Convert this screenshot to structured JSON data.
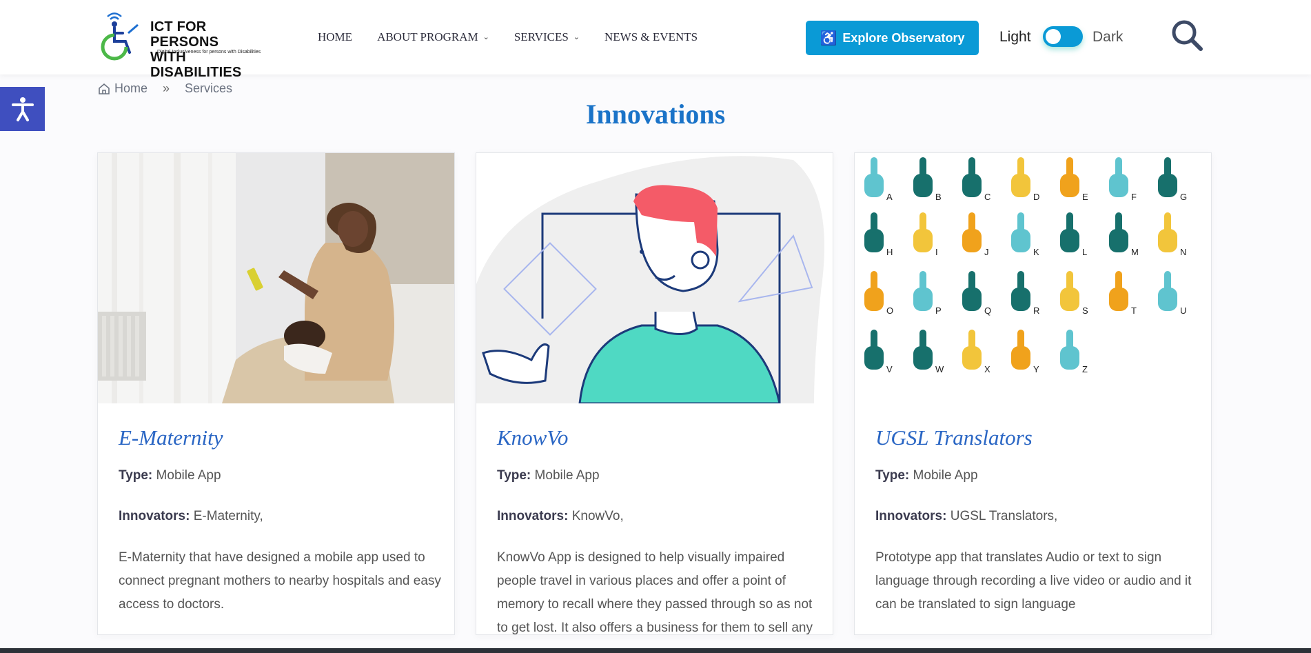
{
  "logo": {
    "title_line1": "ICT FOR PERSONS",
    "title_line2": "WITH DISABILITIES",
    "tagline": "Digital Inclusiveness for persons with Disabilities"
  },
  "nav": {
    "items": [
      {
        "label": "HOME"
      },
      {
        "label": "ABOUT PROGRAM"
      },
      {
        "label": "SERVICES"
      },
      {
        "label": "NEWS & EVENTS"
      }
    ]
  },
  "header": {
    "explore_label": "Explore Observatory",
    "theme_light": "Light",
    "theme_dark": "Dark"
  },
  "breadcrumb": {
    "home": "Home",
    "separator": "»",
    "current": "Services"
  },
  "page_title": "Innovations",
  "cards": [
    {
      "title": "E-Maternity",
      "type_label": "Type:",
      "type_value": "Mobile App",
      "innovators_label": "Innovators:",
      "innovators_value": "E-Maternity,",
      "description": "E-Maternity that have designed a mobile app used to connect pregnant mothers to nearby hospitals and easy access to doctors."
    },
    {
      "title": "KnowVo",
      "type_label": "Type:",
      "type_value": "Mobile App",
      "innovators_label": "Innovators:",
      "innovators_value": "KnowVo,",
      "description": "KnowVo App is designed to help visually impaired people travel in various places and offer a point of memory to recall where they passed through so as not to get lost. It also offers a business for them to sell any assistive devices"
    },
    {
      "title": "UGSL Translators",
      "type_label": "Type:",
      "type_value": "Mobile App",
      "innovators_label": "Innovators:",
      "innovators_value": "UGSL Translators,",
      "description": "Prototype app that translates Audio or text to sign language through recording a live video or audio and it can be translated to sign language"
    }
  ],
  "sign_letters": [
    "A",
    "B",
    "C",
    "D",
    "E",
    "F",
    "G",
    "H",
    "I",
    "J",
    "K",
    "L",
    "M",
    "N",
    "O",
    "P",
    "Q",
    "R",
    "S",
    "T",
    "U",
    "V",
    "W",
    "X",
    "Y",
    "Z"
  ],
  "colors": {
    "accent": "#1a73c8",
    "button": "#0a9ad6",
    "a11y": "#3f4fbf"
  }
}
